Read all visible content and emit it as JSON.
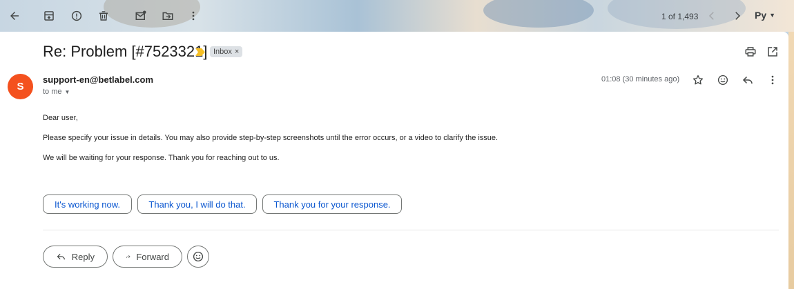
{
  "toolbar": {
    "icons": [
      "back-arrow-icon",
      "archive-icon",
      "report-spam-icon",
      "delete-icon",
      "mark-unread-icon",
      "move-to-icon",
      "more-vert-icon"
    ],
    "pager_text": "1 of 1,493",
    "input_tool_label": "Ру"
  },
  "email": {
    "subject": "Re: Problem [#7523321]",
    "label": "Inbox",
    "label_remove": "×",
    "avatar_letter": "S",
    "sender": "support-en@betlabel.com",
    "to": "to me",
    "time": "01:08 (30 minutes ago)",
    "body": [
      "Dear user,",
      "Please specify your issue in details. You may also provide step-by-step screenshots until the error occurs, or a video to clarify the issue.",
      "We will be waiting for your response. Thank you for reaching out to us."
    ]
  },
  "smart_replies": [
    "It's working now.",
    "Thank you, I will do that.",
    "Thank you for your response."
  ],
  "actions": {
    "reply": "Reply",
    "forward": "Forward"
  },
  "colors": {
    "avatar": "#f4511e",
    "link_blue": "#0b57d0",
    "important_marker": "#f6bf26"
  }
}
